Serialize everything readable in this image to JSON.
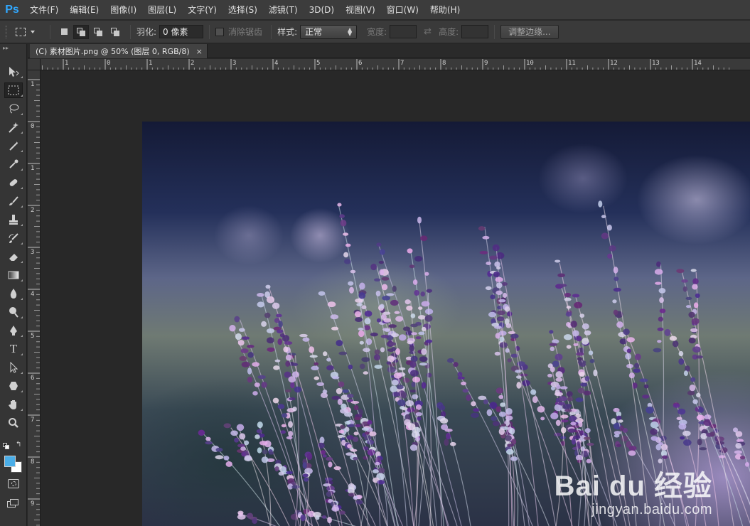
{
  "app": {
    "logo": "Ps",
    "accent": "#31a8ff"
  },
  "menu": [
    "文件(F)",
    "编辑(E)",
    "图像(I)",
    "图层(L)",
    "文字(Y)",
    "选择(S)",
    "滤镜(T)",
    "3D(D)",
    "视图(V)",
    "窗口(W)",
    "帮助(H)"
  ],
  "options": {
    "feather_label": "羽化:",
    "feather_value": "0 像素",
    "antialias_label": "消除锯齿",
    "style_label": "样式:",
    "style_value": "正常",
    "width_label": "宽度:",
    "height_label": "高度:",
    "refine_edge_button": "调整边缘..."
  },
  "document": {
    "tab_title": "(C) 素材图片.png @ 50% (图层 0, RGB/8)",
    "close_glyph": "×"
  },
  "rulers": {
    "top_labels": [
      "2",
      "1",
      "0",
      "1",
      "2",
      "3",
      "4",
      "5",
      "6",
      "7",
      "8",
      "9",
      "10",
      "11",
      "12",
      "13",
      "14"
    ],
    "left_labels": [
      "1",
      "0",
      "1",
      "2",
      "3",
      "4",
      "5",
      "6",
      "7",
      "8",
      "9"
    ]
  },
  "tools": [
    "move-tool-icon",
    "rectangular-marquee-icon",
    "lasso-icon",
    "magic-wand-icon",
    "crop-icon",
    "eyedropper-icon",
    "healing-brush-icon",
    "brush-icon",
    "clone-stamp-icon",
    "history-brush-icon",
    "eraser-icon",
    "gradient-icon",
    "blur-icon",
    "dodge-icon",
    "pen-icon",
    "type-icon",
    "path-selection-icon",
    "shape-icon",
    "hand-icon",
    "zoom-icon"
  ],
  "colors": {
    "foreground": "#4aaee8",
    "background": "#ffffff"
  },
  "watermark": {
    "logo": "Bai  du 经验",
    "sub": "jingyan.baidu.com"
  }
}
